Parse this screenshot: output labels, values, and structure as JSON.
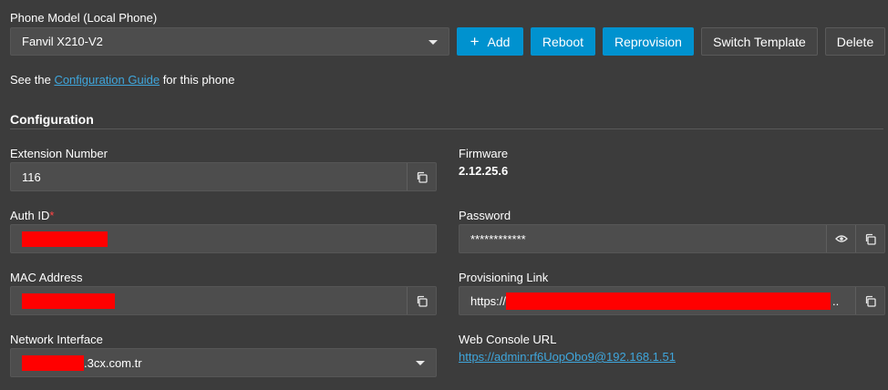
{
  "phone_model": {
    "label": "Phone Model (Local Phone)",
    "value": "Fanvil X210-V2"
  },
  "actions": {
    "add_label": "Add",
    "reboot_label": "Reboot",
    "reprovision_label": "Reprovision",
    "switch_template_label": "Switch Template",
    "delete_label": "Delete"
  },
  "guide": {
    "prefix": "See the ",
    "link_text": "Configuration Guide",
    "suffix": " for this phone"
  },
  "configuration": {
    "heading": "Configuration",
    "extension": {
      "label": "Extension Number",
      "value": "116"
    },
    "firmware": {
      "label": "Firmware",
      "value": "2.12.25.6"
    },
    "auth_id": {
      "label": "Auth ID",
      "required_mark": "*"
    },
    "password": {
      "label": "Password",
      "value": "************"
    },
    "mac": {
      "label": "MAC Address"
    },
    "provisioning": {
      "label": "Provisioning Link",
      "prefix": "https://",
      "ellipsis": ".."
    },
    "network": {
      "label": "Network Interface",
      "suffix": ".3cx.com.tr"
    },
    "web_console": {
      "label": "Web Console URL",
      "value": "https://admin:rf6UopObo9@192.168.1.51"
    }
  },
  "icons": {
    "copy": "copy-icon",
    "eye": "eye-icon",
    "plus": "plus-icon",
    "dropdown": "chevron-down-icon"
  },
  "colors": {
    "background": "#3c3c3c",
    "field": "#4d4d4d",
    "accent": "#0092cf",
    "link": "#3fa6dc",
    "redaction": "#ff0000"
  }
}
